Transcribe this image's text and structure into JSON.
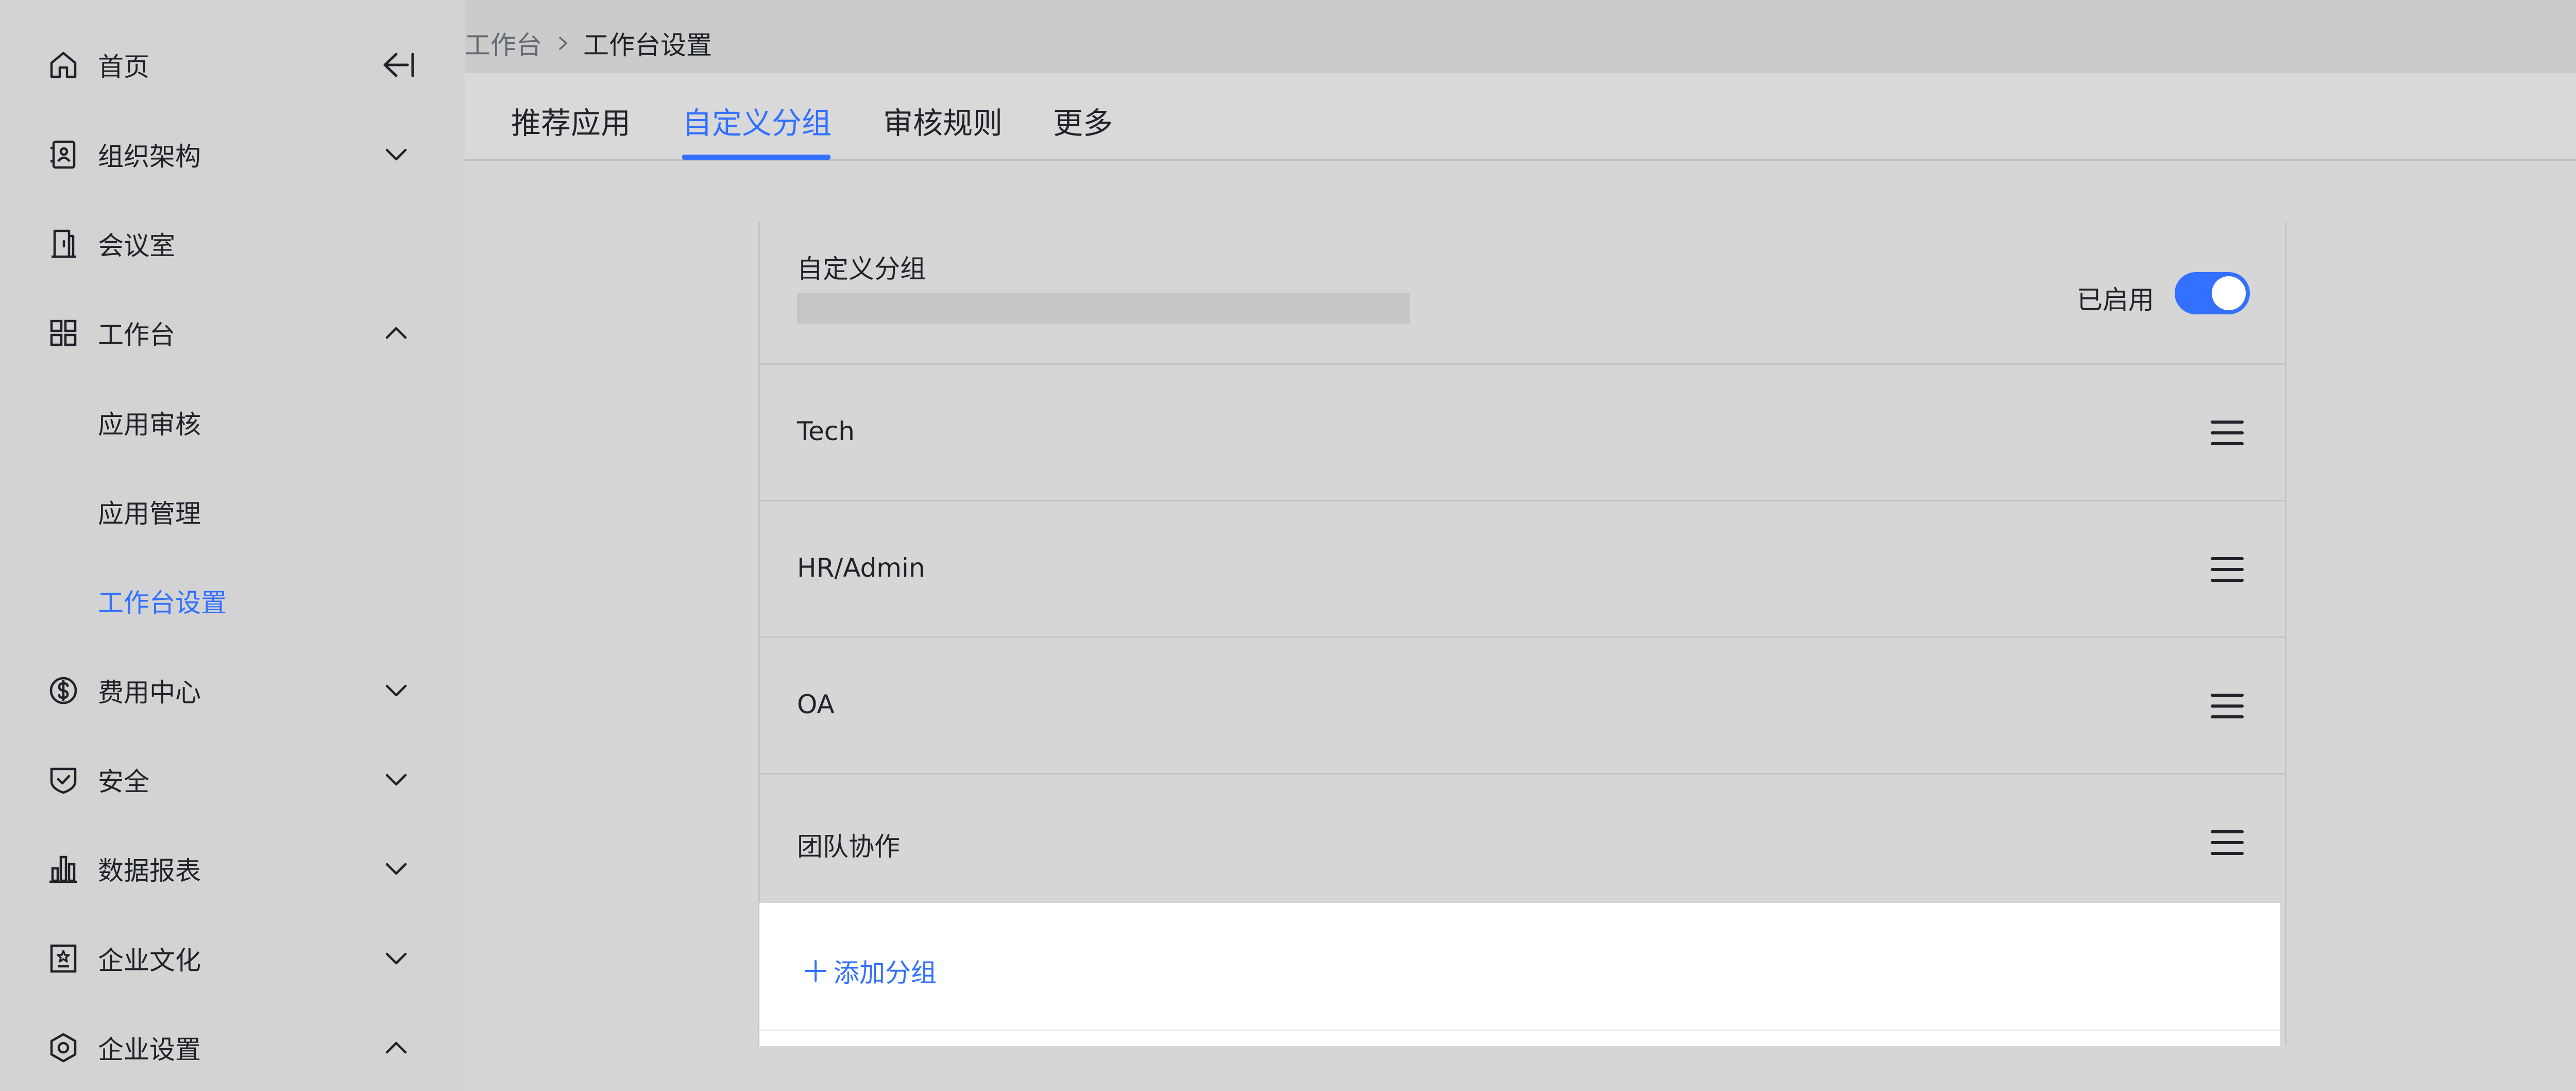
{
  "sidebar": {
    "items": [
      {
        "label": "首页",
        "icon": "home-icon"
      },
      {
        "label": "组织架构",
        "icon": "org-icon",
        "chevron": "down"
      },
      {
        "label": "会议室",
        "icon": "meeting-room-icon"
      },
      {
        "label": "工作台",
        "icon": "workbench-icon",
        "chevron": "up"
      },
      {
        "label": "应用审核"
      },
      {
        "label": "应用管理"
      },
      {
        "label": "工作台设置",
        "active": true
      },
      {
        "label": "费用中心",
        "icon": "dollar-icon",
        "chevron": "down"
      },
      {
        "label": "安全",
        "icon": "shield-icon",
        "chevron": "down"
      },
      {
        "label": "数据报表",
        "icon": "bar-chart-icon",
        "chevron": "down"
      },
      {
        "label": "企业文化",
        "icon": "culture-icon",
        "chevron": "down"
      },
      {
        "label": "企业设置",
        "icon": "settings-hex-icon",
        "chevron": "up"
      }
    ]
  },
  "breadcrumb": {
    "root": "工作台",
    "current": "工作台设置"
  },
  "tabs": [
    {
      "label": "推荐应用"
    },
    {
      "label": "自定义分组",
      "active": true
    },
    {
      "label": "审核规则"
    },
    {
      "label": "更多"
    }
  ],
  "card": {
    "title": "自定义分组",
    "switch_label": "已启用",
    "switch_on": true,
    "groups": [
      {
        "name": "Tech"
      },
      {
        "name": "HR/Admin"
      },
      {
        "name": "OA"
      },
      {
        "name": "团队协作"
      }
    ],
    "add_label": "添加分组"
  },
  "colors": {
    "accent": "#3370ff",
    "text": "#1f2329",
    "muted": "#646a73"
  }
}
